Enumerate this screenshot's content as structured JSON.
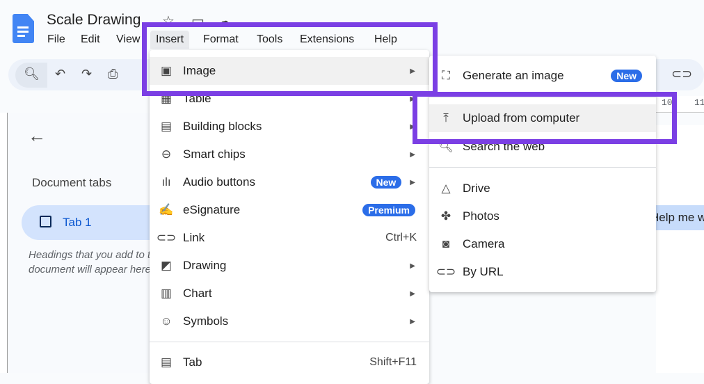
{
  "doc": {
    "title": "Scale Drawing"
  },
  "menubar": [
    "File",
    "Edit",
    "View",
    "Insert",
    "Format",
    "Tools",
    "Extensions",
    "Help"
  ],
  "ruler": [
    "10",
    "11"
  ],
  "sidebar": {
    "heading": "Document tabs",
    "tab": "Tab 1",
    "hint": [
      "Headings that you add to the",
      "document will appear here."
    ]
  },
  "page": {
    "help_chip": "Help me write"
  },
  "insert_menu": [
    {
      "label": "Image",
      "icon": "image-icon"
    },
    {
      "label": "Table",
      "icon": "table-icon"
    },
    {
      "label": "Building blocks",
      "icon": "building-blocks-icon"
    },
    {
      "label": "Smart chips",
      "icon": "smart-chips-icon"
    },
    {
      "label": "Audio buttons",
      "icon": "audio-icon",
      "badge": "New"
    },
    {
      "label": "eSignature",
      "icon": "signature-icon",
      "badge": "Premium"
    },
    {
      "label": "Link",
      "icon": "link-icon",
      "shortcut": "Ctrl+K"
    },
    {
      "label": "Drawing",
      "icon": "drawing-icon"
    },
    {
      "label": "Chart",
      "icon": "chart-icon"
    },
    {
      "label": "Symbols",
      "icon": "symbols-icon"
    },
    {
      "label": "Tab",
      "icon": "tab-icon",
      "shortcut": "Shift+F11"
    }
  ],
  "image_submenu": [
    {
      "label": "Generate an image",
      "badge": "New"
    },
    {
      "label": "Upload from computer"
    },
    {
      "label": "Search the web"
    },
    {
      "label": "Drive"
    },
    {
      "label": "Photos"
    },
    {
      "label": "Camera"
    },
    {
      "label": "By URL"
    }
  ],
  "colors": {
    "highlight": "#7b3fe4",
    "badge": "#2b6de8"
  }
}
